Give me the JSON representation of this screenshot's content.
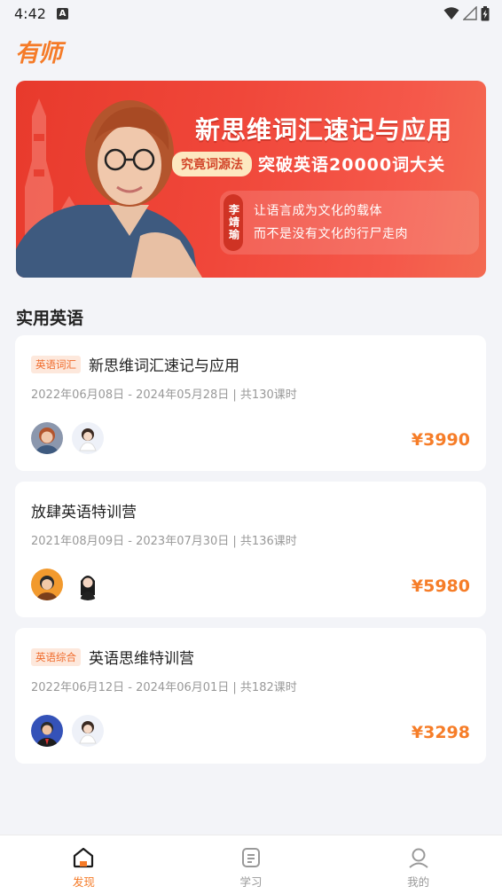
{
  "status": {
    "time": "4:42",
    "badge": "A"
  },
  "app": {
    "logo_text": "有师"
  },
  "banner": {
    "title": "新思维词汇速记与应用",
    "method": "究竟词源法",
    "subtitle": "突破英语20000词大关",
    "teacher": "李靖瑜",
    "quote_line1": "让语言成为文化的载体",
    "quote_line2": "而不是没有文化的行尸走肉"
  },
  "section": {
    "title": "实用英语"
  },
  "courses": [
    {
      "tag": "英语词汇",
      "title": "新思维词汇速记与应用",
      "meta": "2022年06月08日 - 2024年05月28日 | 共130课时",
      "price": "¥3990"
    },
    {
      "tag": "",
      "title": "放肆英语特训营",
      "meta": "2021年08月09日 - 2023年07月30日 | 共136课时",
      "price": "¥5980"
    },
    {
      "tag": "英语综合",
      "title": "英语思维特训营",
      "meta": "2022年06月12日 - 2024年06月01日 | 共182课时",
      "price": "¥3298"
    }
  ],
  "tabs": [
    {
      "label": "发现",
      "icon": "home-icon",
      "active": true
    },
    {
      "label": "学习",
      "icon": "study-icon",
      "active": false
    },
    {
      "label": "我的",
      "icon": "profile-icon",
      "active": false
    }
  ],
  "colors": {
    "accent": "#f57b28",
    "banner_red": "#ee4132",
    "background": "#f3f4f8"
  }
}
